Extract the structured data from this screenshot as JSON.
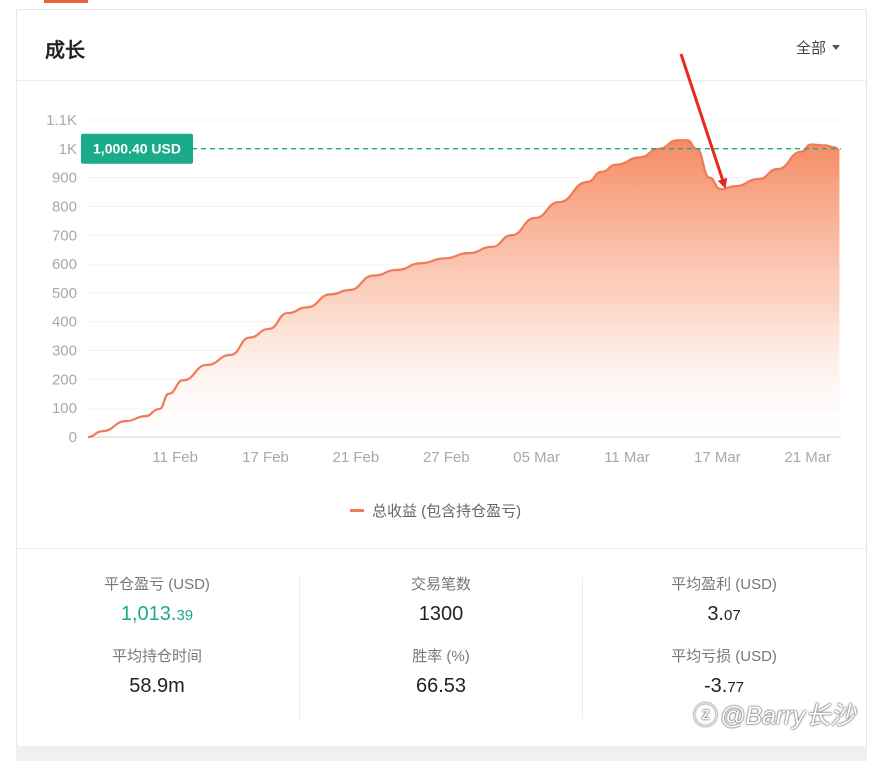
{
  "header": {
    "title": "成长",
    "range_label": "全部"
  },
  "chart_data": {
    "type": "area",
    "y_ticks": [
      "0",
      "100",
      "200",
      "300",
      "400",
      "500",
      "600",
      "700",
      "800",
      "900",
      "1K",
      "1.1K"
    ],
    "x_ticks": [
      "11 Feb",
      "17 Feb",
      "21 Feb",
      "27 Feb",
      "05 Mar",
      "11 Mar",
      "17 Mar",
      "21 Mar"
    ],
    "ylim": [
      0,
      1100
    ],
    "reference_line": {
      "value": 1000.4,
      "label": "1,000.40 USD",
      "color": "#1aab8a"
    },
    "series": [
      {
        "name": "总收益 (包含持仓盈亏)",
        "color": "#ef7b57",
        "points": [
          [
            0,
            0
          ],
          [
            0.9,
            20
          ],
          [
            2.4,
            55
          ],
          [
            3.6,
            72
          ],
          [
            4.5,
            97
          ],
          [
            5.1,
            150
          ],
          [
            6,
            197
          ],
          [
            7.5,
            250
          ],
          [
            9,
            285
          ],
          [
            10.2,
            345
          ],
          [
            11.4,
            375
          ],
          [
            12.6,
            430
          ],
          [
            13.8,
            450
          ],
          [
            15.3,
            495
          ],
          [
            16.5,
            510
          ],
          [
            18,
            560
          ],
          [
            19.5,
            580
          ],
          [
            21,
            603
          ],
          [
            22.5,
            620
          ],
          [
            24,
            638
          ],
          [
            25.5,
            660
          ],
          [
            26.7,
            700
          ],
          [
            28.2,
            760
          ],
          [
            29.7,
            815
          ],
          [
            31.5,
            885
          ],
          [
            32.4,
            920
          ],
          [
            33.3,
            945
          ],
          [
            34.8,
            970
          ],
          [
            36,
            1000
          ],
          [
            37.2,
            1030
          ],
          [
            37.8,
            1030
          ],
          [
            38.4,
            1000
          ],
          [
            39.2,
            900
          ],
          [
            39.9,
            860
          ],
          [
            40.8,
            870
          ],
          [
            42.3,
            895
          ],
          [
            43.5,
            930
          ],
          [
            45,
            990
          ],
          [
            45.6,
            1015
          ],
          [
            46.5,
            1012
          ],
          [
            47.1,
            1005
          ],
          [
            47.4,
            995
          ]
        ]
      }
    ],
    "annotation": {
      "type": "arrow",
      "color": "#e8281c"
    }
  },
  "stats": {
    "closed_pnl_label": "平仓盈亏 (USD)",
    "closed_pnl_main": "1,013.",
    "closed_pnl_frac": "39",
    "trades_label": "交易笔数",
    "trades_value": "1300",
    "avg_profit_label": "平均盈利 (USD)",
    "avg_profit_main": "3.",
    "avg_profit_frac": "07",
    "avg_hold_label": "平均持仓时间",
    "avg_hold_value": "58.9m",
    "win_rate_label": "胜率 (%)",
    "win_rate_value": "66.53",
    "avg_loss_label": "平均亏损 (USD)",
    "avg_loss_main": "-3.",
    "avg_loss_frac": "77"
  },
  "watermark": {
    "icon": "zhihu-icon",
    "text": "@Barry长沙"
  }
}
